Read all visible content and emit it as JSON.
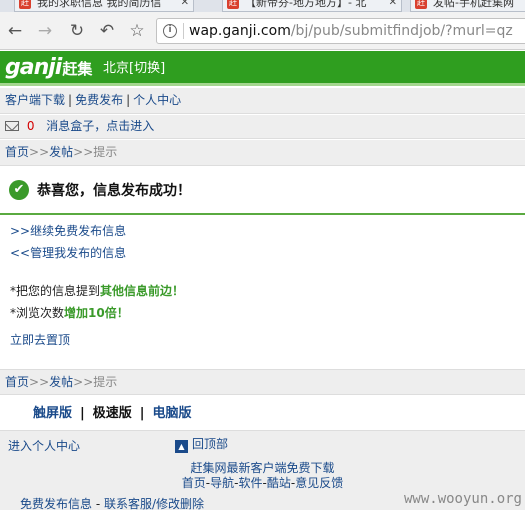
{
  "browser": {
    "tabs": [
      {
        "title": "我的求职信息 我的简历信"
      },
      {
        "title": "【新帝芬-地方地方】- 北"
      },
      {
        "title": "发帖-手机赶集网"
      }
    ],
    "url_host": "wap.ganji.com",
    "url_path": "/bj/pub/submitfindjob/?murl=qz"
  },
  "header": {
    "logo": "ganji",
    "logo_cn": "赶集",
    "city": "北京[切换]"
  },
  "toplinks": [
    "客户端下载",
    "免费发布",
    "个人中心"
  ],
  "messages": {
    "count": "0",
    "text": "消息盒子，点击进入"
  },
  "breadcrumb": {
    "home": "首页",
    "sep": ">>",
    "post": "发帖",
    "tip": "提示"
  },
  "success": {
    "text": "恭喜您，信息发布成功！"
  },
  "actions": {
    "continue": ">>继续免费发布信息",
    "manage": "<<管理我发布的信息"
  },
  "promo": {
    "line1_prefix": "*把您的信息提到",
    "line1_highlight": "其他信息前边！",
    "line2_prefix": "*浏览次数",
    "line2_highlight": "增加10倍！",
    "link": "立即去置顶"
  },
  "versions": {
    "touch": "触屏版",
    "fast": "极速版",
    "pc": "电脑版"
  },
  "footer": {
    "personal": "进入个人中心",
    "top": "回顶部",
    "client": "赶集网最新客户端免费下载",
    "nav": [
      "首页",
      "导航",
      "软件",
      "酷站",
      "意见反馈"
    ],
    "publish": "免费发布信息",
    "service": "联系客服/修改删除"
  },
  "watermark": "www.wooyun.org"
}
